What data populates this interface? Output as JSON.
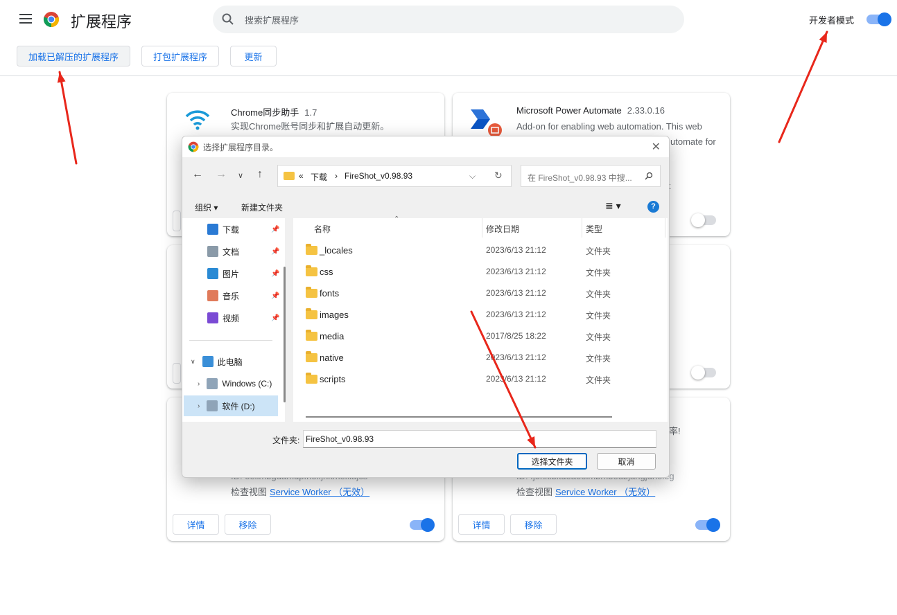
{
  "header": {
    "title": "扩展程序",
    "search_placeholder": "搜索扩展程序",
    "dev_mode_label": "开发者模式",
    "dev_mode_on": true
  },
  "toolbar": {
    "load_unpacked": "加载已解压的扩展程序",
    "pack": "打包扩展程序",
    "update": "更新"
  },
  "cards": {
    "c1": {
      "name": "Chrome同步助手",
      "version": "1.7",
      "desc": "实现Chrome账号同步和扩展自动更新。"
    },
    "c2": {
      "name": "Microsoft Power Automate",
      "version": "2.33.0.16",
      "desc1": "Add-on for enabling web automation. This web",
      "desc2": "utomate for",
      "desc3": "k"
    },
    "c5": {
      "desc_tail": "率!"
    },
    "c5_id_partial": "ID: oeilmbgdamdpfnolfjhkmeklajcs",
    "c6_id_partial": "ID: fjonklbkdeaeeimbmbedbjangjdnoleg",
    "inspect_label": "检查视图",
    "service_worker_link": "Service Worker （无效）",
    "details": "详情",
    "remove": "移除"
  },
  "dialog": {
    "title": "选择扩展程序目录。",
    "path": [
      "«",
      "下载",
      "›",
      "FireShot_v0.98.93"
    ],
    "search_placeholder": "在 FireShot_v0.98.93 中搜...",
    "organize": "组织 ▾",
    "new_folder": "新建文件夹",
    "nav_items": [
      {
        "label": "下载",
        "color": "#2a7ad4"
      },
      {
        "label": "文档",
        "color": "#8a9aa8"
      },
      {
        "label": "图片",
        "color": "#2a8ad4"
      },
      {
        "label": "音乐",
        "color": "#e07a5a"
      },
      {
        "label": "视频",
        "color": "#7a4ad4"
      }
    ],
    "this_pc": "此电脑",
    "drives": [
      "Windows (C:)",
      "软件 (D:)"
    ],
    "columns": {
      "name": "名称",
      "date": "修改日期",
      "type": "类型"
    },
    "files": [
      {
        "name": "_locales",
        "date": "2023/6/13 21:12",
        "type": "文件夹"
      },
      {
        "name": "css",
        "date": "2023/6/13 21:12",
        "type": "文件夹"
      },
      {
        "name": "fonts",
        "date": "2023/6/13 21:12",
        "type": "文件夹"
      },
      {
        "name": "images",
        "date": "2023/6/13 21:12",
        "type": "文件夹"
      },
      {
        "name": "media",
        "date": "2017/8/25 18:22",
        "type": "文件夹"
      },
      {
        "name": "native",
        "date": "2023/6/13 21:12",
        "type": "文件夹"
      },
      {
        "name": "scripts",
        "date": "2023/6/13 21:12",
        "type": "文件夹"
      }
    ],
    "folder_label": "文件夹:",
    "folder_value": "FireShot_v0.98.93",
    "select_button": "选择文件夹",
    "cancel_button": "取消"
  },
  "annotation_color": "#e8271b"
}
